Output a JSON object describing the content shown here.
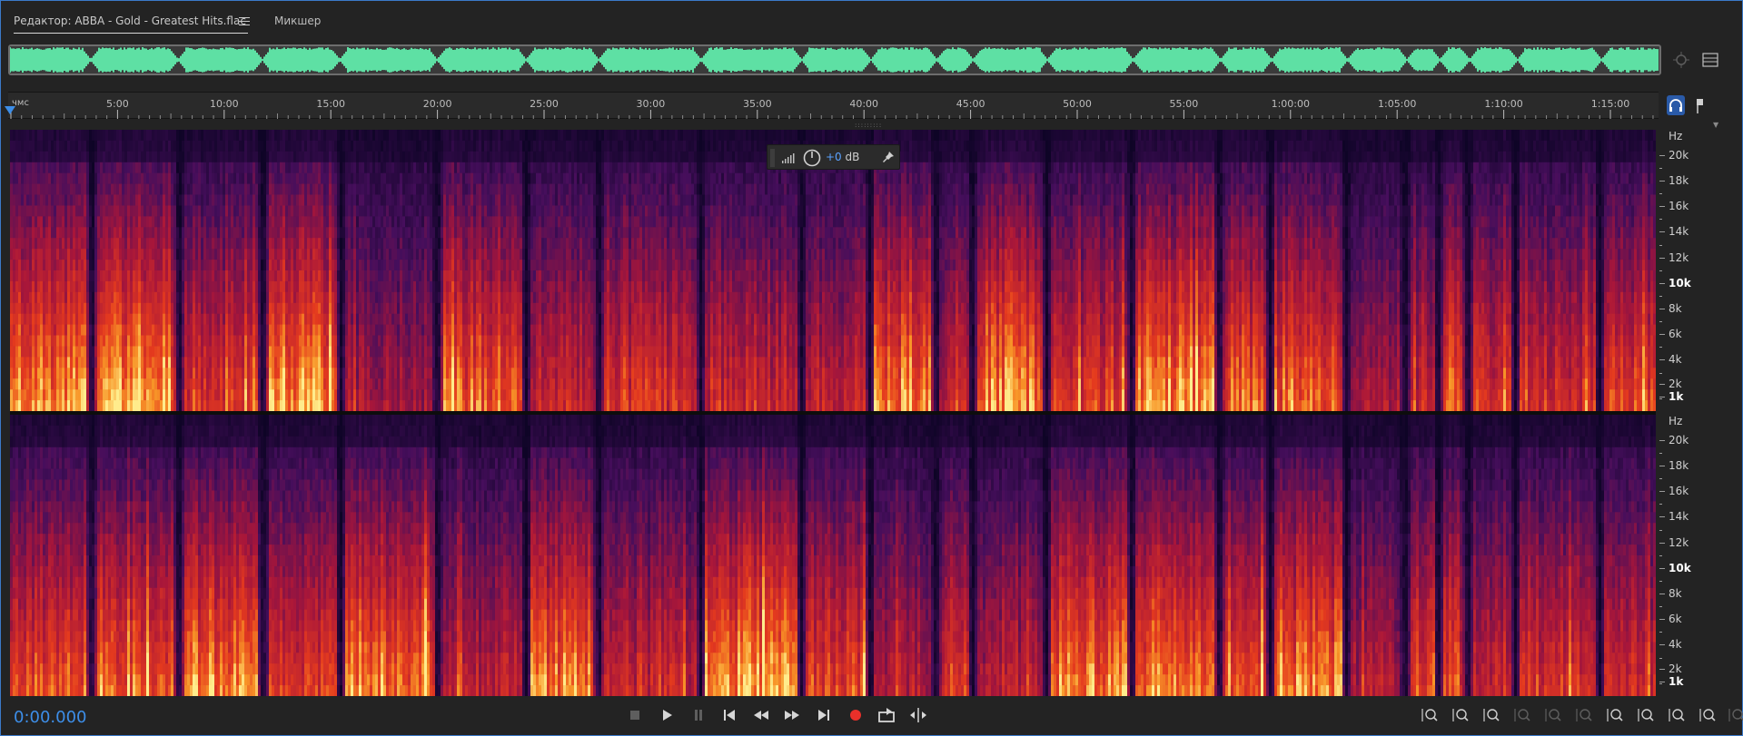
{
  "tabs": {
    "editor_label": "Редактор: ABBA - Gold - Greatest Hits.flac",
    "mixer_label": "Микшер"
  },
  "ruler": {
    "unit": "чмс",
    "labels": [
      "5:00",
      "10:00",
      "15:00",
      "20:00",
      "25:00",
      "30:00",
      "35:00",
      "40:00",
      "45:00",
      "50:00",
      "55:00",
      "1:00:00",
      "1:05:00",
      "1:10:00",
      "1:15:00"
    ]
  },
  "hud": {
    "db_value": "+0",
    "db_unit": "dB"
  },
  "frequency_axis": {
    "unit": "Hz",
    "labels": [
      "20k",
      "18k",
      "16k",
      "14k",
      "12k",
      "10k",
      "8k",
      "6k",
      "4k",
      "2k",
      "1k"
    ]
  },
  "transport": {
    "timecode": "0:00.000",
    "buttons": [
      "stop",
      "play",
      "pause",
      "skip-to-start",
      "rewind",
      "fast-forward",
      "skip-to-end",
      "record",
      "loop-playback",
      "skip-selection"
    ]
  },
  "zoom_tools": [
    "zoom-in-amplitude",
    "zoom-out-amplitude",
    "zoom-in-time",
    "zoom-out-full",
    "zoom-out-time",
    "zoom-to-selection",
    "zoom-in-left",
    "zoom-in-right",
    "zoom-in-center",
    "zoom-reset",
    "zoom-full-both"
  ],
  "colors": {
    "accent": "#3d8ee8",
    "waveform": "#5ee0a4",
    "record": "#e8302a",
    "spectrogram_low": "#12052a",
    "spectrogram_mid": "#b4182c",
    "spectrogram_high": "#ffe98a"
  }
}
